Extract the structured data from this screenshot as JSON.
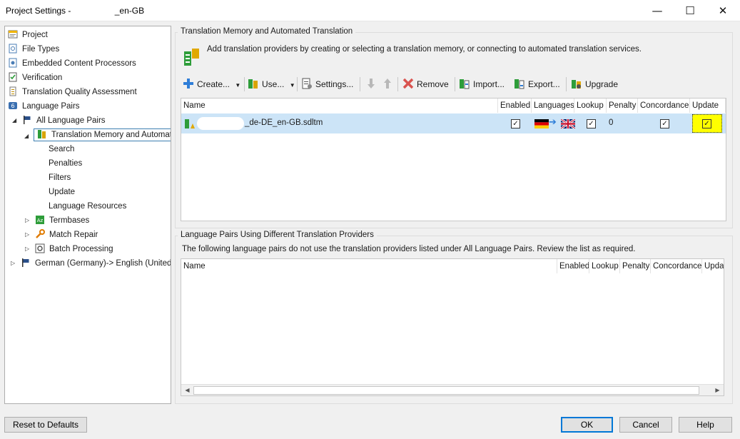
{
  "window": {
    "title": "Project Settings - ",
    "title_suffix": "_en-GB",
    "min_glyph": "—",
    "max_glyph": "☐",
    "close_glyph": "✕"
  },
  "tree": [
    {
      "label": "Project",
      "icon": "project-icon"
    },
    {
      "label": "File Types",
      "icon": "file-types-icon"
    },
    {
      "label": "Embedded Content Processors",
      "icon": "processor-icon"
    },
    {
      "label": "Verification",
      "icon": "verification-icon"
    },
    {
      "label": "Translation Quality Assessment",
      "icon": "tqa-icon"
    },
    {
      "label": "Language Pairs",
      "icon": "language-pairs-icon"
    },
    {
      "label": "All Language Pairs",
      "icon": "flag-icon"
    },
    {
      "label": "Translation Memory and Automat",
      "icon": "tm-icon"
    },
    {
      "label": "Search"
    },
    {
      "label": "Penalties"
    },
    {
      "label": "Filters"
    },
    {
      "label": "Update"
    },
    {
      "label": "Language Resources"
    },
    {
      "label": "Termbases",
      "icon": "termbase-icon"
    },
    {
      "label": "Match Repair",
      "icon": "wrench-icon"
    },
    {
      "label": "Batch Processing",
      "icon": "batch-icon"
    },
    {
      "label": "German (Germany)-> English (United",
      "icon": "flag-icon"
    }
  ],
  "tm_section": {
    "title": "Translation Memory and Automated Translation",
    "description": "Add translation providers by creating or selecting a translation memory, or connecting to automated translation services.",
    "toolbar": {
      "create": "Create...",
      "use": "Use...",
      "settings": "Settings...",
      "remove": "Remove",
      "import": "Import...",
      "export": "Export...",
      "upgrade": "Upgrade"
    },
    "columns": [
      "Name",
      "Enabled",
      "Languages",
      "Lookup",
      "Penalty",
      "Concordance",
      "Update"
    ],
    "rows": [
      {
        "name": "_de-DE_en-GB.sdltm",
        "enabled": true,
        "source_lang": "de-DE",
        "target_lang": "en-GB",
        "lookup": true,
        "penalty": "0",
        "concordance": true,
        "update": true
      }
    ]
  },
  "lp_section": {
    "title": "Language Pairs Using Different Translation Providers",
    "description": "The following language pairs do not use the translation providers listed under All Language Pairs. Review the list as required.",
    "columns": [
      "Name",
      "Enabled",
      "Lookup",
      "Penalty",
      "Concordance",
      "Upda"
    ]
  },
  "buttons": {
    "reset": "Reset to Defaults",
    "ok": "OK",
    "cancel": "Cancel",
    "help": "Help"
  },
  "check_glyph": "✓",
  "colors": {
    "selection": "#cce4f7",
    "highlight": "#ffff00",
    "accent": "#0078d7",
    "remove_red": "#d9534f",
    "plus_blue": "#2f7ed8",
    "tm_green": "#2e9d3a"
  }
}
